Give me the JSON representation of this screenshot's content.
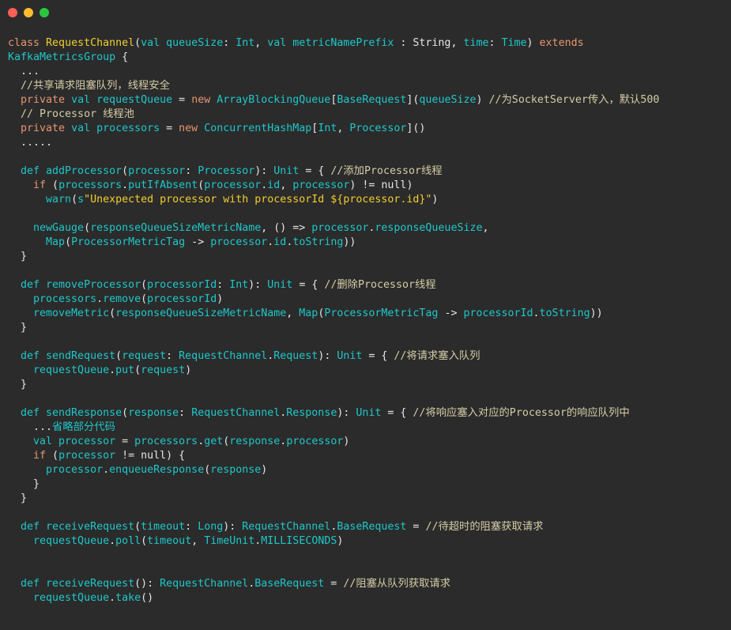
{
  "window": {
    "buttons": [
      {
        "name": "close",
        "color": "#fe5f57"
      },
      {
        "name": "minimize",
        "color": "#febc2e"
      },
      {
        "name": "maximize",
        "color": "#28c840"
      }
    ]
  },
  "code": {
    "lines": [
      [
        [
          "k",
          "class "
        ],
        [
          "t",
          "RequestChannel"
        ],
        [
          "p",
          "("
        ],
        [
          "i",
          "val queueSize"
        ],
        [
          "p",
          ": "
        ],
        [
          "i",
          "Int"
        ],
        [
          "p",
          ", "
        ],
        [
          "i",
          "val metricNamePrefix"
        ],
        [
          "p",
          " : String, "
        ],
        [
          "i",
          "time"
        ],
        [
          "p",
          ": "
        ],
        [
          "i",
          "Time"
        ],
        [
          "p",
          ") "
        ],
        [
          "k",
          "extends"
        ]
      ],
      [
        [
          "i",
          "KafkaMetricsGroup"
        ],
        [
          "p",
          " {"
        ]
      ],
      [
        [
          "p",
          "  ..."
        ]
      ],
      [
        [
          "c",
          "  //共享请求阻塞队列，线程安全"
        ]
      ],
      [
        [
          "k",
          "  private "
        ],
        [
          "i",
          "val requestQueue"
        ],
        [
          "p",
          " = "
        ],
        [
          "k",
          "new "
        ],
        [
          "i",
          "ArrayBlockingQueue"
        ],
        [
          "p",
          "["
        ],
        [
          "i",
          "BaseRequest"
        ],
        [
          "p",
          "]("
        ],
        [
          "i",
          "queueSize"
        ],
        [
          "p",
          ") "
        ],
        [
          "c",
          "//为SocketServer传入，默认500"
        ]
      ],
      [
        [
          "c",
          "  // Processor 线程池"
        ]
      ],
      [
        [
          "k",
          "  private "
        ],
        [
          "i",
          "val processors"
        ],
        [
          "p",
          " = "
        ],
        [
          "k",
          "new "
        ],
        [
          "i",
          "ConcurrentHashMap"
        ],
        [
          "p",
          "["
        ],
        [
          "i",
          "Int"
        ],
        [
          "p",
          ", "
        ],
        [
          "i",
          "Processor"
        ],
        [
          "p",
          "]()"
        ]
      ],
      [
        [
          "p",
          "  ....."
        ]
      ],
      [],
      [
        [
          "i",
          "  def addProcessor"
        ],
        [
          "p",
          "("
        ],
        [
          "i",
          "processor"
        ],
        [
          "p",
          ": "
        ],
        [
          "i",
          "Processor"
        ],
        [
          "p",
          "): "
        ],
        [
          "i",
          "Unit"
        ],
        [
          "p",
          " = { "
        ],
        [
          "c",
          "//添加Processor线程"
        ]
      ],
      [
        [
          "k",
          "    if "
        ],
        [
          "p",
          "("
        ],
        [
          "i",
          "processors"
        ],
        [
          "p",
          "."
        ],
        [
          "i",
          "putIfAbsent"
        ],
        [
          "p",
          "("
        ],
        [
          "i",
          "processor"
        ],
        [
          "p",
          "."
        ],
        [
          "i",
          "id"
        ],
        [
          "p",
          ", "
        ],
        [
          "i",
          "processor"
        ],
        [
          "p",
          ") != null)"
        ]
      ],
      [
        [
          "i",
          "      warn"
        ],
        [
          "p",
          "("
        ],
        [
          "i",
          "s"
        ],
        [
          "s",
          "\"Unexpected processor with processorId ${processor.id}\""
        ],
        [
          "p",
          ")"
        ]
      ],
      [],
      [
        [
          "i",
          "    newGauge"
        ],
        [
          "p",
          "("
        ],
        [
          "i",
          "responseQueueSizeMetricName"
        ],
        [
          "p",
          ", () => "
        ],
        [
          "i",
          "processor"
        ],
        [
          "p",
          "."
        ],
        [
          "i",
          "responseQueueSize"
        ],
        [
          "p",
          ","
        ]
      ],
      [
        [
          "i",
          "      Map"
        ],
        [
          "p",
          "("
        ],
        [
          "i",
          "ProcessorMetricTag"
        ],
        [
          "p",
          " -> "
        ],
        [
          "i",
          "processor"
        ],
        [
          "p",
          "."
        ],
        [
          "i",
          "id"
        ],
        [
          "p",
          "."
        ],
        [
          "i",
          "toString"
        ],
        [
          "p",
          "))"
        ]
      ],
      [
        [
          "p",
          "  }"
        ]
      ],
      [],
      [
        [
          "i",
          "  def removeProcessor"
        ],
        [
          "p",
          "("
        ],
        [
          "i",
          "processorId"
        ],
        [
          "p",
          ": "
        ],
        [
          "i",
          "Int"
        ],
        [
          "p",
          "): "
        ],
        [
          "i",
          "Unit"
        ],
        [
          "p",
          " = { "
        ],
        [
          "c",
          "//删除Processor线程"
        ]
      ],
      [
        [
          "i",
          "    processors"
        ],
        [
          "p",
          "."
        ],
        [
          "i",
          "remove"
        ],
        [
          "p",
          "("
        ],
        [
          "i",
          "processorId"
        ],
        [
          "p",
          ")"
        ]
      ],
      [
        [
          "i",
          "    removeMetric"
        ],
        [
          "p",
          "("
        ],
        [
          "i",
          "responseQueueSizeMetricName"
        ],
        [
          "p",
          ", "
        ],
        [
          "i",
          "Map"
        ],
        [
          "p",
          "("
        ],
        [
          "i",
          "ProcessorMetricTag"
        ],
        [
          "p",
          " -> "
        ],
        [
          "i",
          "processorId"
        ],
        [
          "p",
          "."
        ],
        [
          "i",
          "toString"
        ],
        [
          "p",
          "))"
        ]
      ],
      [
        [
          "p",
          "  }"
        ]
      ],
      [],
      [
        [
          "i",
          "  def sendRequest"
        ],
        [
          "p",
          "("
        ],
        [
          "i",
          "request"
        ],
        [
          "p",
          ": "
        ],
        [
          "i",
          "RequestChannel"
        ],
        [
          "p",
          "."
        ],
        [
          "i",
          "Request"
        ],
        [
          "p",
          "): "
        ],
        [
          "i",
          "Unit"
        ],
        [
          "p",
          " = { "
        ],
        [
          "c",
          "//将请求塞入队列"
        ]
      ],
      [
        [
          "i",
          "    requestQueue"
        ],
        [
          "p",
          "."
        ],
        [
          "i",
          "put"
        ],
        [
          "p",
          "("
        ],
        [
          "i",
          "request"
        ],
        [
          "p",
          ")"
        ]
      ],
      [
        [
          "p",
          "  }"
        ]
      ],
      [],
      [
        [
          "i",
          "  def sendResponse"
        ],
        [
          "p",
          "("
        ],
        [
          "i",
          "response"
        ],
        [
          "p",
          ": "
        ],
        [
          "i",
          "RequestChannel"
        ],
        [
          "p",
          "."
        ],
        [
          "i",
          "Response"
        ],
        [
          "p",
          "): "
        ],
        [
          "i",
          "Unit"
        ],
        [
          "p",
          " = { "
        ],
        [
          "c",
          "//将响应塞入对应的Processor的响应队列中"
        ]
      ],
      [
        [
          "p",
          "    ..."
        ],
        [
          "i",
          "省略部分代码"
        ]
      ],
      [
        [
          "i",
          "    val processor"
        ],
        [
          "p",
          " = "
        ],
        [
          "i",
          "processors"
        ],
        [
          "p",
          "."
        ],
        [
          "i",
          "get"
        ],
        [
          "p",
          "("
        ],
        [
          "i",
          "response"
        ],
        [
          "p",
          "."
        ],
        [
          "i",
          "processor"
        ],
        [
          "p",
          ")"
        ]
      ],
      [
        [
          "k",
          "    if "
        ],
        [
          "p",
          "("
        ],
        [
          "i",
          "processor"
        ],
        [
          "p",
          " != null) {"
        ]
      ],
      [
        [
          "i",
          "      processor"
        ],
        [
          "p",
          "."
        ],
        [
          "i",
          "enqueueResponse"
        ],
        [
          "p",
          "("
        ],
        [
          "i",
          "response"
        ],
        [
          "p",
          ")"
        ]
      ],
      [
        [
          "p",
          "    }"
        ]
      ],
      [
        [
          "p",
          "  }"
        ]
      ],
      [],
      [
        [
          "i",
          "  def receiveRequest"
        ],
        [
          "p",
          "("
        ],
        [
          "i",
          "timeout"
        ],
        [
          "p",
          ": "
        ],
        [
          "i",
          "Long"
        ],
        [
          "p",
          "): "
        ],
        [
          "i",
          "RequestChannel"
        ],
        [
          "p",
          "."
        ],
        [
          "i",
          "BaseRequest"
        ],
        [
          "p",
          " = "
        ],
        [
          "c",
          "//待超时的阻塞获取请求"
        ]
      ],
      [
        [
          "i",
          "    requestQueue"
        ],
        [
          "p",
          "."
        ],
        [
          "i",
          "poll"
        ],
        [
          "p",
          "("
        ],
        [
          "i",
          "timeout"
        ],
        [
          "p",
          ", "
        ],
        [
          "i",
          "TimeUnit"
        ],
        [
          "p",
          "."
        ],
        [
          "i",
          "MILLISECONDS"
        ],
        [
          "p",
          ")"
        ]
      ],
      [],
      [],
      [
        [
          "i",
          "  def receiveRequest"
        ],
        [
          "p",
          "(): "
        ],
        [
          "i",
          "RequestChannel"
        ],
        [
          "p",
          "."
        ],
        [
          "i",
          "BaseRequest"
        ],
        [
          "p",
          " = "
        ],
        [
          "c",
          "//阻塞从队列获取请求"
        ]
      ],
      [
        [
          "i",
          "    requestQueue"
        ],
        [
          "p",
          "."
        ],
        [
          "i",
          "take"
        ],
        [
          "p",
          "()"
        ]
      ]
    ]
  }
}
